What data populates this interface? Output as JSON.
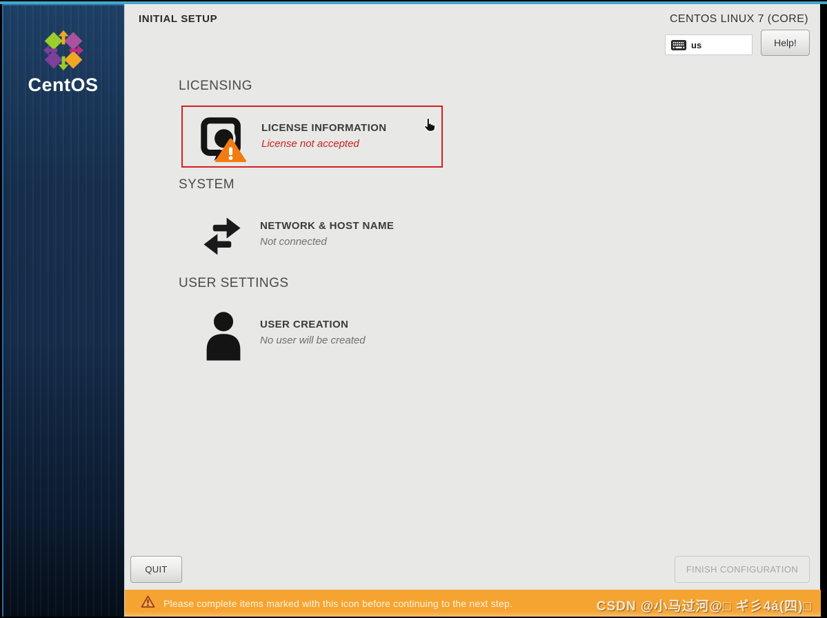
{
  "header": {
    "title": "INITIAL SETUP",
    "product": "CENTOS LINUX 7 (CORE)",
    "keyboard_layout": "us",
    "help_button": "Help!"
  },
  "sidebar": {
    "brand": "CentOS"
  },
  "hub": {
    "sections": [
      {
        "header": "LICENSING",
        "items": [
          {
            "title": "LICENSE INFORMATION",
            "status": "License not accepted",
            "icon": "license-icon",
            "attention": true
          }
        ]
      },
      {
        "header": "SYSTEM",
        "items": [
          {
            "title": "NETWORK & HOST NAME",
            "status": "Not connected",
            "icon": "network-icon",
            "attention": false
          }
        ]
      },
      {
        "header": "USER SETTINGS",
        "items": [
          {
            "title": "USER CREATION",
            "status": "No user will be created",
            "icon": "user-icon",
            "attention": false
          }
        ]
      }
    ]
  },
  "footer": {
    "quit_button": "QUIT",
    "finish_button": "FINISH CONFIGURATION",
    "warning": "Please complete items marked with this icon before continuing to the next step.",
    "watermark": "CSDN @小马过河@□ ギ彡4á(四)□"
  },
  "colors": {
    "warning_bar_orange": "#f6a431",
    "attention_red": "#cc2222",
    "selection_border_red": "#d41f1f",
    "sidebar_navy": "#152c4a",
    "content_bg": "#e8e8e6",
    "warning_triangle_orange": "#f07c12",
    "top_border_blue": "#41a8c9"
  }
}
